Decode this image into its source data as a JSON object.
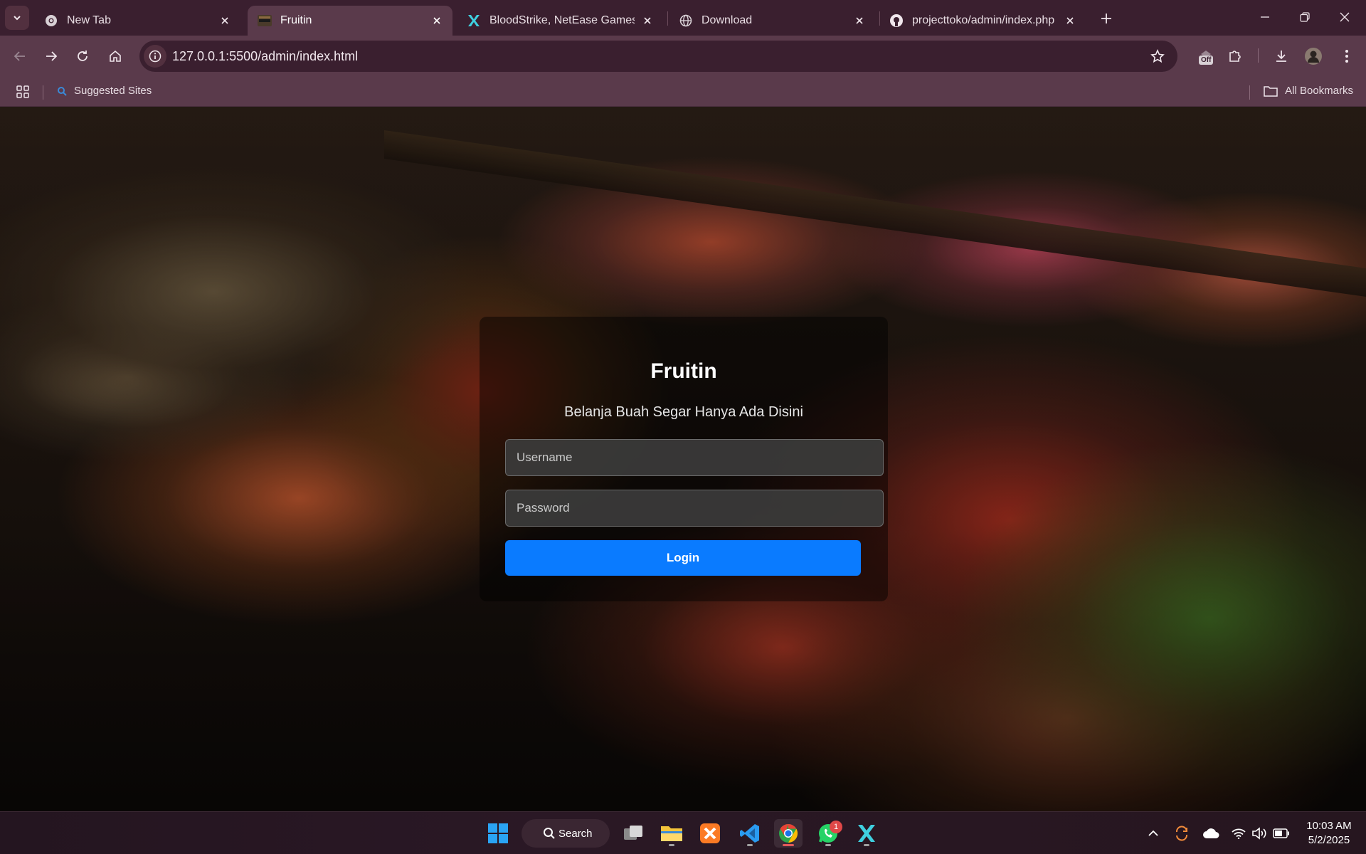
{
  "browser": {
    "tabs": [
      {
        "title": "New Tab",
        "favicon": "chrome-icon",
        "active": false
      },
      {
        "title": "Fruitin",
        "favicon": "page-thumbnail-icon",
        "active": true
      },
      {
        "title": "BloodStrike, NetEase Games' fa",
        "favicon": "bloodstrike-icon",
        "active": false
      },
      {
        "title": "Download",
        "favicon": "globe-icon",
        "active": false
      },
      {
        "title": "projecttoko/admin/index.php a",
        "favicon": "github-icon",
        "active": false
      }
    ],
    "url": "127.0.0.1:5500/admin/index.html",
    "extension_badge": "Off",
    "bookmarks": {
      "items": [
        {
          "label": "Suggested Sites"
        }
      ],
      "all_label": "All Bookmarks"
    }
  },
  "login": {
    "title": "Fruitin",
    "subtitle": "Belanja Buah Segar Hanya Ada Disini",
    "username_placeholder": "Username",
    "password_placeholder": "Password",
    "button_label": "Login"
  },
  "taskbar": {
    "search_label": "Search",
    "whatsapp_badge": "1",
    "time": "10:03 AM",
    "date": "5/2/2025"
  },
  "colors": {
    "tab_bar": "#3a1f2f",
    "toolbar": "#5a3a4b",
    "login_button": "#0a7bff"
  }
}
